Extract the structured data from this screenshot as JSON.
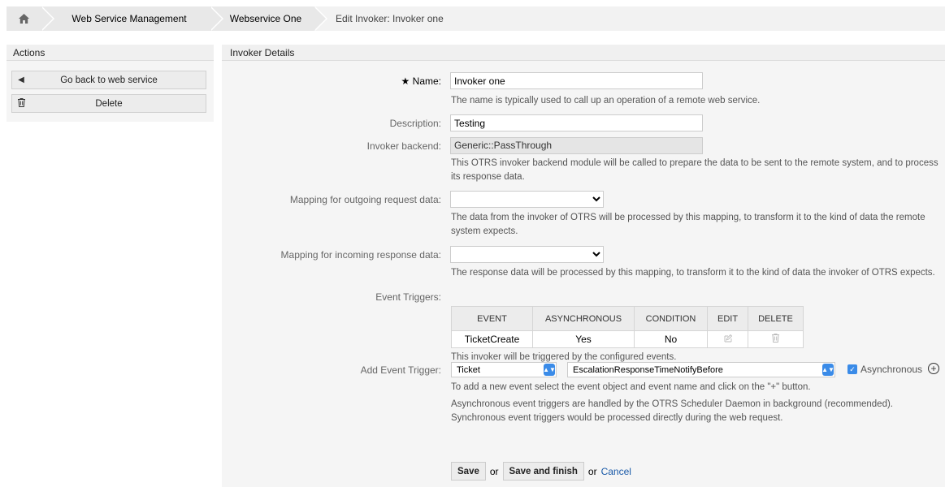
{
  "breadcrumb": {
    "home_icon": "home-icon",
    "items": [
      "Web Service Management",
      "Webservice One"
    ],
    "current": "Edit Invoker: Invoker one"
  },
  "sidebar": {
    "title": "Actions",
    "back_label": "Go back to web service",
    "delete_label": "Delete"
  },
  "main": {
    "title": "Invoker Details",
    "name": {
      "required_mark": "★",
      "label": "Name:",
      "value": "Invoker one",
      "help": "The name is typically used to call up an operation of a remote web service."
    },
    "description": {
      "label": "Description:",
      "value": "Testing"
    },
    "backend": {
      "label": "Invoker backend:",
      "value": "Generic::PassThrough",
      "help_line1": "This OTRS invoker backend module will be called to prepare the data to be sent to the remote system, and to process",
      "help_line2": "its response data."
    },
    "mapping_out": {
      "label": "Mapping for outgoing request data:",
      "value": "",
      "help_line1": "The data from the invoker of OTRS will be processed by this mapping, to transform it to the kind of data the remote",
      "help_line2": "system expects."
    },
    "mapping_in": {
      "label": "Mapping for incoming response data:",
      "value": "",
      "help": "The response data will be processed by this mapping, to transform it to the kind of data the invoker of OTRS expects."
    },
    "event_triggers": {
      "label": "Event Triggers:",
      "columns": [
        "EVENT",
        "ASYNCHRONOUS",
        "CONDITION",
        "EDIT",
        "DELETE"
      ],
      "rows": [
        {
          "event": "TicketCreate",
          "asynchronous": "Yes",
          "condition": "No"
        }
      ],
      "help": "This invoker will be triggered by the configured events."
    },
    "add_trigger": {
      "label": "Add Event Trigger:",
      "object_value": "Ticket",
      "event_value": "EscalationResponseTimeNotifyBefore",
      "async_label": "Asynchronous",
      "async_checked": true,
      "help1": "To add a new event select the event object and event name and click on the \"+\" button.",
      "help2_line1": "Asynchronous event triggers are handled by the OTRS Scheduler Daemon in background (recommended).",
      "help2_line2": "Synchronous event triggers would be processed directly during the web request."
    },
    "buttons": {
      "save": "Save",
      "or1": "or",
      "save_finish": "Save and finish",
      "or2": "or",
      "cancel": "Cancel"
    }
  }
}
